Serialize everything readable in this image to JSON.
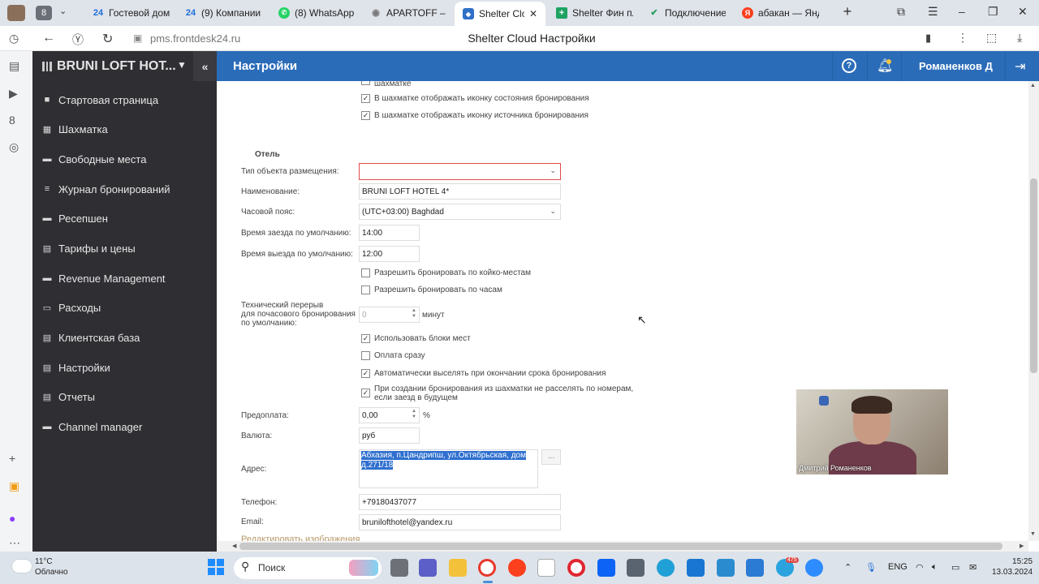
{
  "browser": {
    "tab_counter": "8",
    "tabs": [
      {
        "label": "Гостевой дом",
        "icon": "24"
      },
      {
        "label": "(9) Компании",
        "icon": "24"
      },
      {
        "label": "(8) WhatsApp",
        "icon": "wa"
      },
      {
        "label": "APARTOFF – Ор",
        "icon": "pin"
      },
      {
        "label": "Shelter Clou",
        "icon": "shelter"
      },
      {
        "label": "Shelter Фин пл",
        "icon": "plus"
      },
      {
        "label": "Подключение",
        "icon": "check"
      },
      {
        "label": "абакан — Янде",
        "icon": "Я"
      }
    ],
    "url": "pms.frontdesk24.ru",
    "page_title": "Shelter Cloud Настройки"
  },
  "app": {
    "hotel_name": "BRUNI LOFT HOT...",
    "page_title": "Настройки",
    "user_name": "Романенков Д"
  },
  "sidebar": {
    "items": [
      {
        "label": "Стартовая страница",
        "icon": "■"
      },
      {
        "label": "Шахматка",
        "icon": "▦"
      },
      {
        "label": "Свободные места",
        "icon": "▬"
      },
      {
        "label": "Журнал бронирований",
        "icon": "≡"
      },
      {
        "label": "Ресепшен",
        "icon": "▬"
      },
      {
        "label": "Тарифы и цены",
        "icon": "▤"
      },
      {
        "label": "Revenue Management",
        "icon": "▬"
      },
      {
        "label": "Расходы",
        "icon": "▭"
      },
      {
        "label": "Клиентская база",
        "icon": "▤"
      },
      {
        "label": "Настройки",
        "icon": "▤"
      },
      {
        "label": "Отчеты",
        "icon": "▤"
      },
      {
        "label": "Channel manager",
        "icon": "▬"
      }
    ]
  },
  "form": {
    "top_cut_label": "шахматке",
    "top_checkboxes": [
      {
        "label": "В шахматке отображать иконку состояния бронирования",
        "checked": true
      },
      {
        "label": "В шахматке отображать иконку источника бронирования",
        "checked": true
      }
    ],
    "section_title": "Отель",
    "property_type": {
      "label": "Тип объекта размещения:",
      "value": ""
    },
    "name": {
      "label": "Наименование:",
      "value": "BRUNI LOFT HOTEL 4*"
    },
    "timezone": {
      "label": "Часовой пояс:",
      "value": "(UTC+03:00) Baghdad"
    },
    "checkin": {
      "label": "Время заезда по умолчанию:",
      "value": "14:00"
    },
    "checkout": {
      "label": "Время выезда по умолчанию:",
      "value": "12:00"
    },
    "mid_checkboxes": [
      {
        "label": "Разрешить бронировать по койко-местам",
        "checked": false
      },
      {
        "label": "Разрешить бронировать по часам",
        "checked": false
      }
    ],
    "break": {
      "label1": "Технический перерыв",
      "label2": "для почасового бронирования",
      "label3": "по умолчанию:",
      "value": "0",
      "unit": "минут"
    },
    "low_checkboxes": [
      {
        "label": "Использовать блоки мест",
        "checked": true
      },
      {
        "label": "Оплата сразу",
        "checked": false
      },
      {
        "label": "Автоматически выселять при окончании срока бронирования",
        "checked": true
      },
      {
        "label1": "При создании бронирования из шахматки не расселять по номерам,",
        "label2": "если заезд в будущем",
        "checked": true
      }
    ],
    "prepay": {
      "label": "Предоплата:",
      "value": "0,00",
      "unit": "%"
    },
    "currency": {
      "label": "Валюта:",
      "value": "руб"
    },
    "address": {
      "label": "Адрес:",
      "line1": "Абхазия, п.Цандрипш, ул.Октябрьская, дом",
      "line2": "д.271/18",
      "button": "..."
    },
    "phone": {
      "label": "Телефон:",
      "value": "+79180437077"
    },
    "email": {
      "label": "Email:",
      "value": "brunilofthotel@yandex.ru"
    },
    "edit_images": "Редактировать изображения"
  },
  "video": {
    "name": "Дмитрий Романенков"
  },
  "taskbar": {
    "temp": "11°C",
    "weather": "Облачно",
    "search": "Поиск",
    "lang": "ENG",
    "time": "15:25",
    "date": "13.03.2024",
    "badge": "475"
  }
}
